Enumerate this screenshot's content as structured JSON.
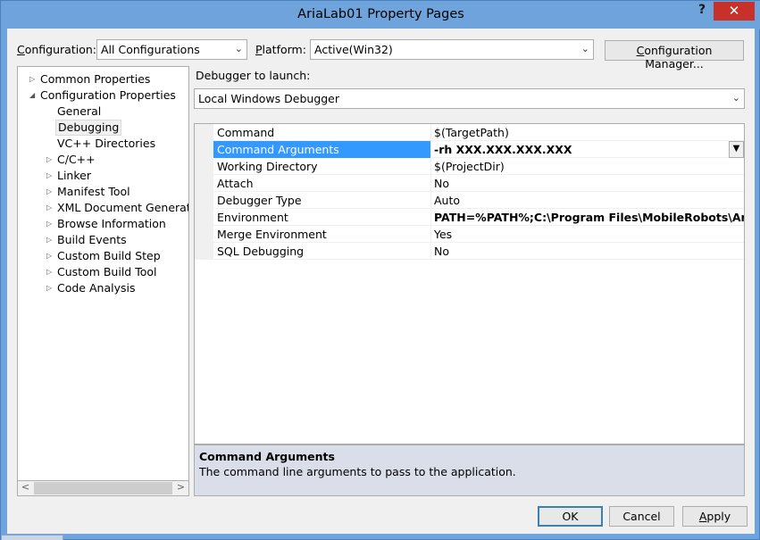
{
  "window": {
    "title": "AriaLab01 Property Pages",
    "help_glyph": "?",
    "close_glyph": "✕"
  },
  "header": {
    "configuration_label_u": "C",
    "configuration_label_rest": "onfiguration:",
    "configuration_value": "All Configurations",
    "platform_label_u": "P",
    "platform_label_rest": "latform:",
    "platform_value": "Active(Win32)",
    "config_manager_u": "C",
    "config_manager_rest": "onfiguration Manager..."
  },
  "tree": {
    "items": [
      {
        "label": "Common Properties",
        "expander": "▷"
      },
      {
        "label": "Configuration Properties",
        "expander": "◢"
      },
      {
        "label": "General"
      },
      {
        "label": "Debugging"
      },
      {
        "label": "VC++ Directories"
      },
      {
        "label": "C/C++",
        "expander": "▷"
      },
      {
        "label": "Linker",
        "expander": "▷"
      },
      {
        "label": "Manifest Tool",
        "expander": "▷"
      },
      {
        "label": "XML Document Generator",
        "expander": "▷"
      },
      {
        "label": "Browse Information",
        "expander": "▷"
      },
      {
        "label": "Build Events",
        "expander": "▷"
      },
      {
        "label": "Custom Build Step",
        "expander": "▷"
      },
      {
        "label": "Custom Build Tool",
        "expander": "▷"
      },
      {
        "label": "Code Analysis",
        "expander": "▷"
      }
    ],
    "scroll_left": "<",
    "scroll_right": ">"
  },
  "debugger": {
    "label": "Debugger to launch:",
    "value": "Local Windows Debugger"
  },
  "properties": [
    {
      "name": "Command",
      "value": "$(TargetPath)"
    },
    {
      "name": "Command Arguments",
      "value": "-rh XXX.XXX.XXX.XXX"
    },
    {
      "name": "Working Directory",
      "value": "$(ProjectDir)"
    },
    {
      "name": "Attach",
      "value": "No"
    },
    {
      "name": "Debugger Type",
      "value": "Auto"
    },
    {
      "name": "Environment",
      "value": "PATH=%PATH%;C:\\Program Files\\MobileRobots\\Aria\\bin"
    },
    {
      "name": "Merge Environment",
      "value": "Yes"
    },
    {
      "name": "SQL Debugging",
      "value": "No"
    }
  ],
  "description": {
    "title": "Command Arguments",
    "text": "The command line arguments to pass to the application."
  },
  "buttons": {
    "ok": "OK",
    "cancel": "Cancel",
    "apply_u": "A",
    "apply_rest": "pply"
  },
  "colors": {
    "selection": "#3399ff",
    "title_bar": "#6ea3dc",
    "close": "#c7312a"
  }
}
